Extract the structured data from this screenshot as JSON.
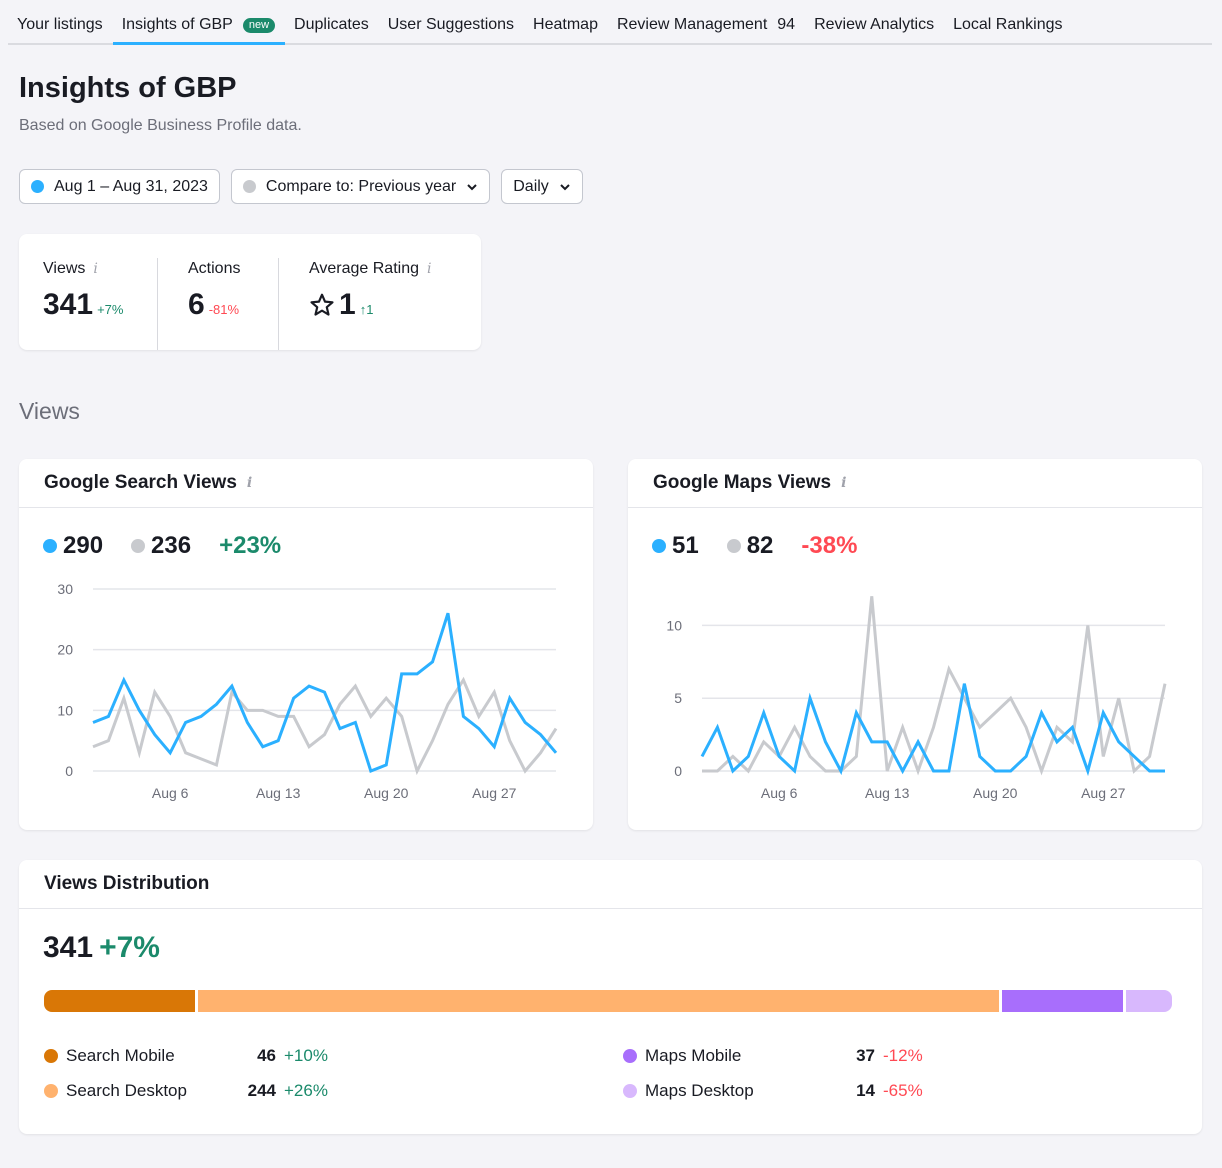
{
  "nav": {
    "tabs": [
      {
        "label": "Your listings"
      },
      {
        "label": "Insights of GBP",
        "badge": "new",
        "active": true
      },
      {
        "label": "Duplicates"
      },
      {
        "label": "User Suggestions"
      },
      {
        "label": "Heatmap"
      },
      {
        "label": "Review Management",
        "count": "94"
      },
      {
        "label": "Review Analytics"
      },
      {
        "label": "Local Rankings"
      }
    ]
  },
  "page": {
    "title": "Insights of GBP",
    "subtitle": "Based on Google Business Profile data."
  },
  "filters": {
    "date_range": "Aug 1 – Aug 31, 2023",
    "compare": "Compare to: Previous year",
    "granularity": "Daily"
  },
  "colors": {
    "current": "#2bb0ff",
    "previous": "#c8cace",
    "positive": "#1b8a6b",
    "negative": "#ff4953",
    "search_mobile": "#d97706",
    "search_desktop": "#ffb26e",
    "maps_mobile": "#a86efc",
    "maps_desktop": "#d8b8fd"
  },
  "kpis": {
    "views": {
      "label": "Views",
      "value": "341",
      "delta": "+7%"
    },
    "actions": {
      "label": "Actions",
      "value": "6",
      "delta": "-81%"
    },
    "rating": {
      "label": "Average Rating",
      "value": "1",
      "delta": "↑1"
    }
  },
  "views_section_title": "Views",
  "search_card": {
    "title": "Google Search Views",
    "current_total": "290",
    "previous_total": "236",
    "delta": "+23%"
  },
  "maps_card": {
    "title": "Google Maps Views",
    "current_total": "51",
    "previous_total": "82",
    "delta": "-38%"
  },
  "distribution": {
    "title": "Views Distribution",
    "total": "341",
    "delta": "+7%",
    "items": [
      {
        "name": "Search Mobile",
        "value": 46,
        "value_label": "46",
        "delta": "+10%",
        "color_key": "search_mobile"
      },
      {
        "name": "Search Desktop",
        "value": 244,
        "value_label": "244",
        "delta": "+26%",
        "color_key": "search_desktop"
      },
      {
        "name": "Maps Mobile",
        "value": 37,
        "value_label": "37",
        "delta": "-12%",
        "color_key": "maps_mobile"
      },
      {
        "name": "Maps Desktop",
        "value": 14,
        "value_label": "14",
        "delta": "-65%",
        "color_key": "maps_desktop"
      }
    ]
  },
  "chart_data": [
    {
      "type": "line",
      "title": "Google Search Views",
      "x": [
        "Aug 1",
        "Aug 2",
        "Aug 3",
        "Aug 4",
        "Aug 5",
        "Aug 6",
        "Aug 7",
        "Aug 8",
        "Aug 9",
        "Aug 10",
        "Aug 11",
        "Aug 12",
        "Aug 13",
        "Aug 14",
        "Aug 15",
        "Aug 16",
        "Aug 17",
        "Aug 18",
        "Aug 19",
        "Aug 20",
        "Aug 21",
        "Aug 22",
        "Aug 23",
        "Aug 24",
        "Aug 25",
        "Aug 26",
        "Aug 27",
        "Aug 28",
        "Aug 29",
        "Aug 30",
        "Aug 31"
      ],
      "xticks": [
        "Aug 6",
        "Aug 13",
        "Aug 20",
        "Aug 27"
      ],
      "yticks": [
        0,
        10,
        20,
        30
      ],
      "ylim": [
        0,
        30
      ],
      "grid": true,
      "series": [
        {
          "name": "Aug 1 – Aug 31, 2023",
          "values": [
            8,
            9,
            15,
            10,
            6,
            3,
            8,
            9,
            11,
            14,
            8,
            4,
            5,
            12,
            14,
            13,
            7,
            8,
            0,
            1,
            16,
            16,
            18,
            26,
            9,
            7,
            4,
            12,
            8,
            6,
            3
          ]
        },
        {
          "name": "Previous year",
          "values": [
            4,
            5,
            12,
            3,
            13,
            9,
            3,
            2,
            1,
            13,
            10,
            10,
            9,
            9,
            4,
            6,
            11,
            14,
            9,
            12,
            9,
            0,
            5,
            11,
            15,
            9,
            13,
            5,
            0,
            3,
            7
          ]
        }
      ]
    },
    {
      "type": "line",
      "title": "Google Maps Views",
      "x": [
        "Aug 1",
        "Aug 2",
        "Aug 3",
        "Aug 4",
        "Aug 5",
        "Aug 6",
        "Aug 7",
        "Aug 8",
        "Aug 9",
        "Aug 10",
        "Aug 11",
        "Aug 12",
        "Aug 13",
        "Aug 14",
        "Aug 15",
        "Aug 16",
        "Aug 17",
        "Aug 18",
        "Aug 19",
        "Aug 20",
        "Aug 21",
        "Aug 22",
        "Aug 23",
        "Aug 24",
        "Aug 25",
        "Aug 26",
        "Aug 27",
        "Aug 28",
        "Aug 29",
        "Aug 30",
        "Aug 31"
      ],
      "xticks": [
        "Aug 6",
        "Aug 13",
        "Aug 20",
        "Aug 27"
      ],
      "yticks": [
        0,
        5,
        10
      ],
      "ylim": [
        0,
        12.5
      ],
      "grid": true,
      "series": [
        {
          "name": "Aug 1 – Aug 31, 2023",
          "values": [
            1,
            3,
            0,
            1,
            4,
            1,
            0,
            5,
            2,
            0,
            4,
            2,
            2,
            0,
            2,
            0,
            0,
            6,
            1,
            0,
            0,
            1,
            4,
            2,
            3,
            0,
            4,
            2,
            1,
            0,
            0
          ]
        },
        {
          "name": "Previous year",
          "values": [
            0,
            0,
            1,
            0,
            2,
            1,
            3,
            1,
            0,
            0,
            1,
            12,
            0,
            3,
            0,
            3,
            7,
            5,
            3,
            4,
            5,
            3,
            0,
            3,
            2,
            10,
            1,
            5,
            0,
            1,
            6
          ]
        }
      ]
    }
  ]
}
